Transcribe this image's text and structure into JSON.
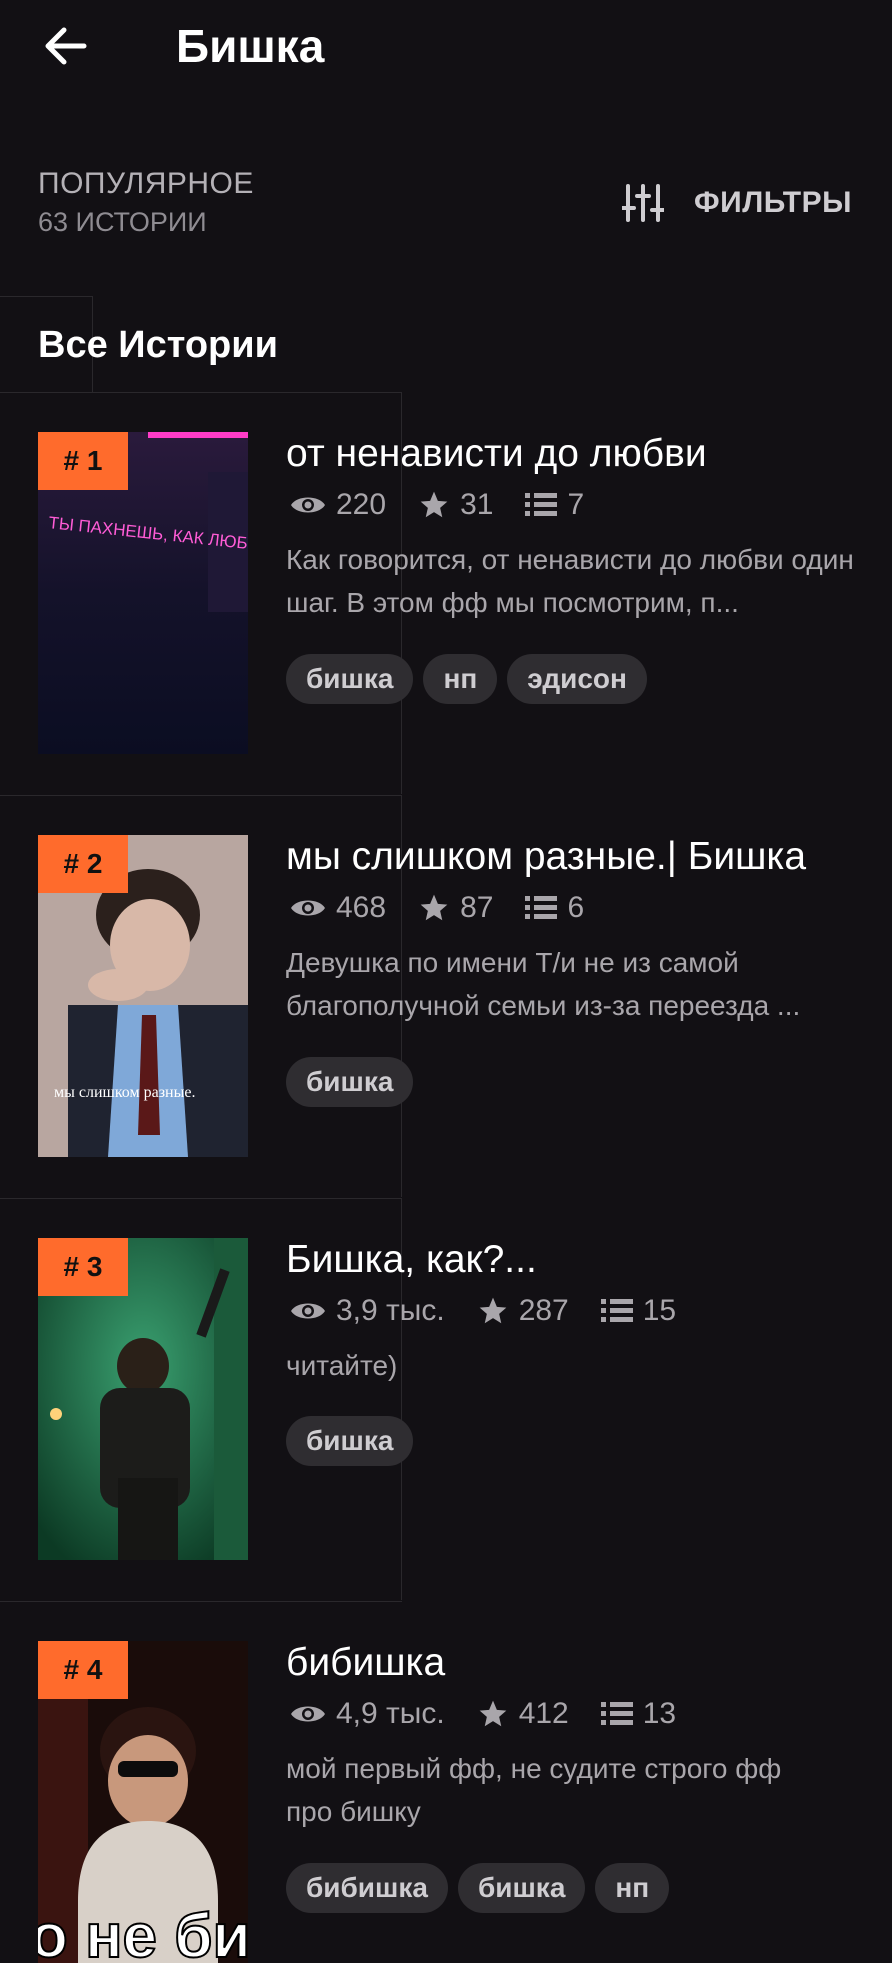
{
  "header": {
    "title": "Бишка"
  },
  "section": {
    "label": "ПОПУЛЯРНОЕ",
    "count": "63 ИСТОРИИ",
    "filters_label": "ФИЛЬТРЫ"
  },
  "tab": {
    "label": "Все Истории"
  },
  "stories": [
    {
      "rank": "# 1",
      "title": "от ненависти до любви",
      "views": "220",
      "stars": "31",
      "parts": "7",
      "description": "Как говорится, от ненависти до любви один шаг. В этом фф мы посмотрим, п...",
      "tags": [
        "бишка",
        "нп",
        "эдисон"
      ],
      "cover_text": "ТЫ ПАХНЕШЬ, КАК ЛЮБОВЬ"
    },
    {
      "rank": "# 2",
      "title": "мы слишком разные.| Бишка",
      "views": "468",
      "stars": "87",
      "parts": "6",
      "description": "Девушка по имени Т/и не из самой благополучной семьи из-за переезда ...",
      "tags": [
        "бишка"
      ],
      "cover_text": "мы слишком разные."
    },
    {
      "rank": "# 3",
      "title": "Бишка, как?...",
      "views": "3,9 тыс.",
      "stars": "287",
      "parts": "15",
      "description": "читайте)",
      "tags": [
        "бишка"
      ]
    },
    {
      "rank": "# 4",
      "title": "бибишка",
      "views": "4,9 тыс.",
      "stars": "412",
      "parts": "13",
      "description": "мой первый фф, не судите строго фф про бишку",
      "tags": [
        "бибишка",
        "бишка",
        "нп"
      ],
      "cover_text": "о не би"
    }
  ]
}
